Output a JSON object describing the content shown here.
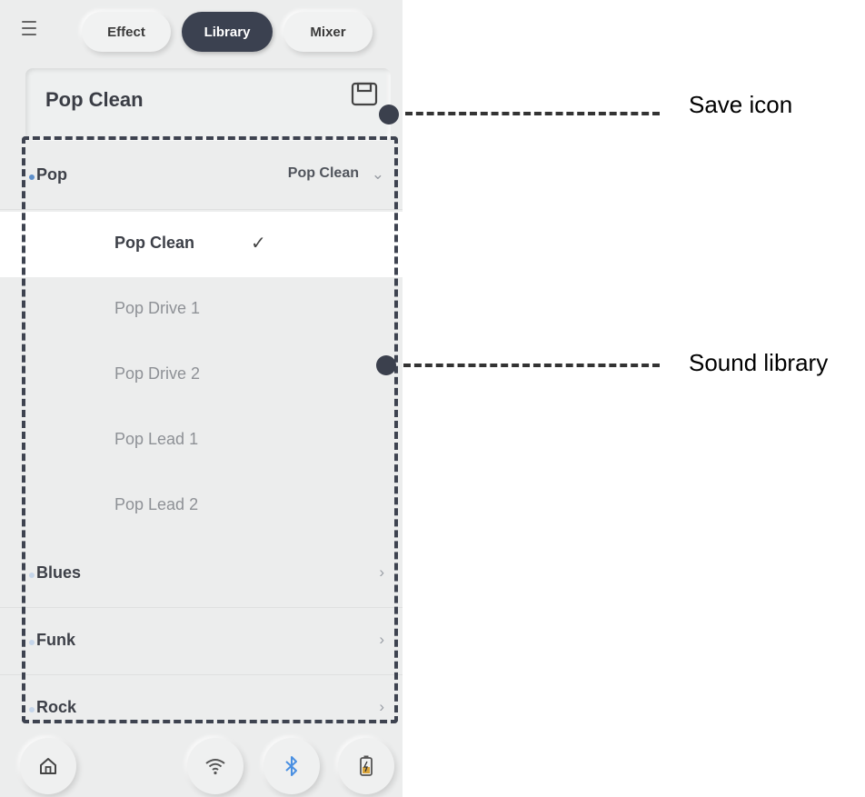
{
  "tabs": [
    {
      "label": "Effect",
      "active": false
    },
    {
      "label": "Library",
      "active": true
    },
    {
      "label": "Mixer",
      "active": false
    }
  ],
  "preset": {
    "name": "Pop Clean"
  },
  "categories": [
    {
      "label": "Pop",
      "value": "Pop Clean",
      "expanded": true
    },
    {
      "label": "Blues",
      "value": "",
      "expanded": false
    },
    {
      "label": "Funk",
      "value": "",
      "expanded": false
    },
    {
      "label": "Rock",
      "value": "",
      "expanded": false
    }
  ],
  "pop_items": [
    {
      "label": "Pop Clean",
      "selected": true
    },
    {
      "label": "Pop Drive 1",
      "selected": false
    },
    {
      "label": "Pop Drive 2",
      "selected": false
    },
    {
      "label": "Pop Lead 1",
      "selected": false
    },
    {
      "label": "Pop Lead 2",
      "selected": false
    }
  ],
  "callouts": {
    "save": "Save icon",
    "library": "Sound library"
  },
  "bottom_icons": [
    "home-icon",
    "wifi-icon",
    "bluetooth-icon",
    "battery-icon"
  ],
  "colors": {
    "active_tab": "#3b4150",
    "accent_blue": "#5e8fca",
    "panel_bg": "#eceded"
  }
}
